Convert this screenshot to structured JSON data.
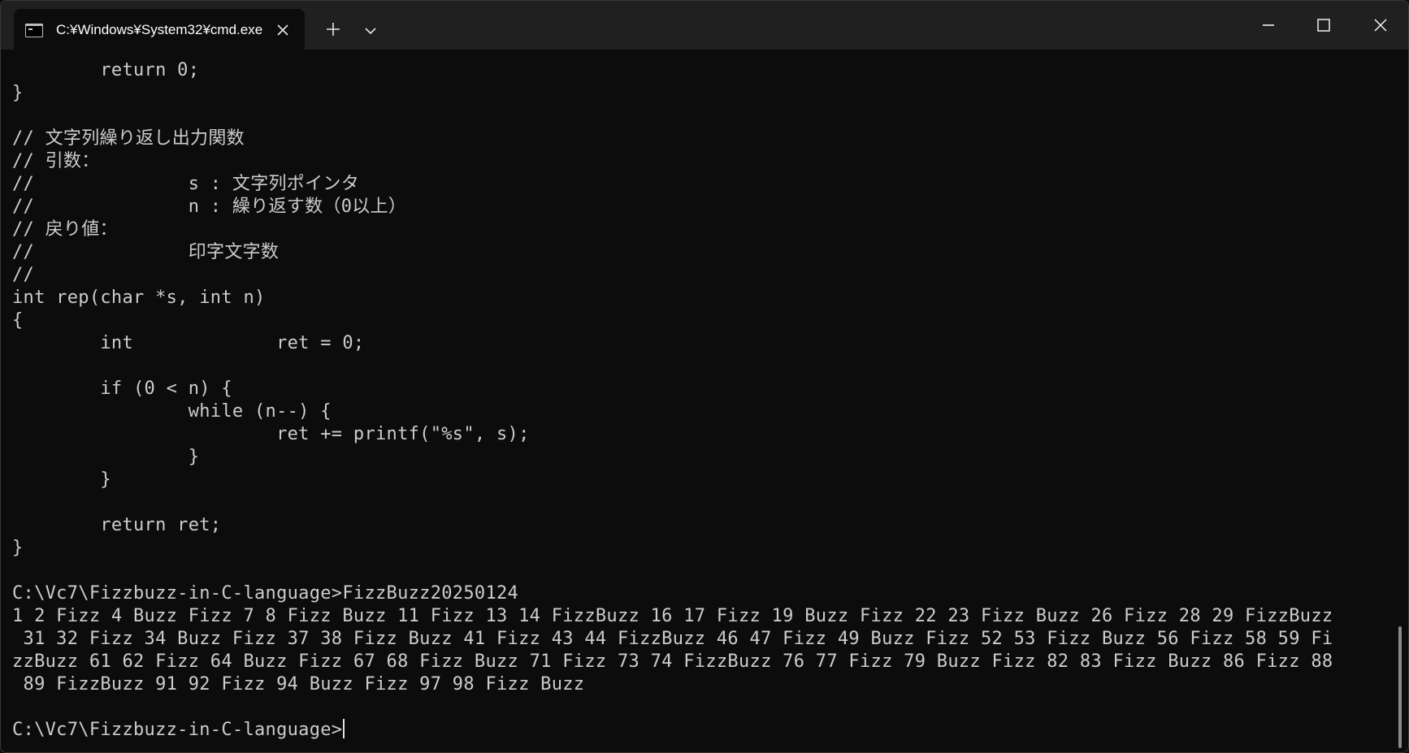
{
  "window": {
    "tab_title": "C:¥Windows¥System32¥cmd.exe",
    "new_tab_glyph": "+",
    "colors": {
      "titlebar": "#202020",
      "background": "#0c0c0c",
      "text": "#cccccc"
    }
  },
  "terminal": {
    "lines": [
      "        return 0;",
      "}",
      "",
      "// 文字列繰り返し出力関数",
      "// 引数：",
      "//              s : 文字列ポインタ",
      "//              n : 繰り返す数（0以上）",
      "// 戻り値：",
      "//              印字文字数",
      "//",
      "int rep(char *s, int n)",
      "{",
      "        int             ret = 0;",
      "",
      "        if (0 < n) {",
      "                while (n--) {",
      "                        ret += printf(\"%s\", s);",
      "                }",
      "        }",
      "",
      "        return ret;",
      "}",
      "",
      "C:\\Vc7\\Fizzbuzz-in-C-language>FizzBuzz20250124",
      "1 2 Fizz 4 Buzz Fizz 7 8 Fizz Buzz 11 Fizz 13 14 FizzBuzz 16 17 Fizz 19 Buzz Fizz 22 23 Fizz Buzz 26 Fizz 28 29 FizzBuzz",
      " 31 32 Fizz 34 Buzz Fizz 37 38 Fizz Buzz 41 Fizz 43 44 FizzBuzz 46 47 Fizz 49 Buzz Fizz 52 53 Fizz Buzz 56 Fizz 58 59 Fi",
      "zzBuzz 61 62 Fizz 64 Buzz Fizz 67 68 Fizz Buzz 71 Fizz 73 74 FizzBuzz 76 77 Fizz 79 Buzz Fizz 82 83 Fizz Buzz 86 Fizz 88",
      " 89 FizzBuzz 91 92 Fizz 94 Buzz Fizz 97 98 Fizz Buzz",
      ""
    ],
    "prompt": "C:\\Vc7\\Fizzbuzz-in-C-language>"
  }
}
